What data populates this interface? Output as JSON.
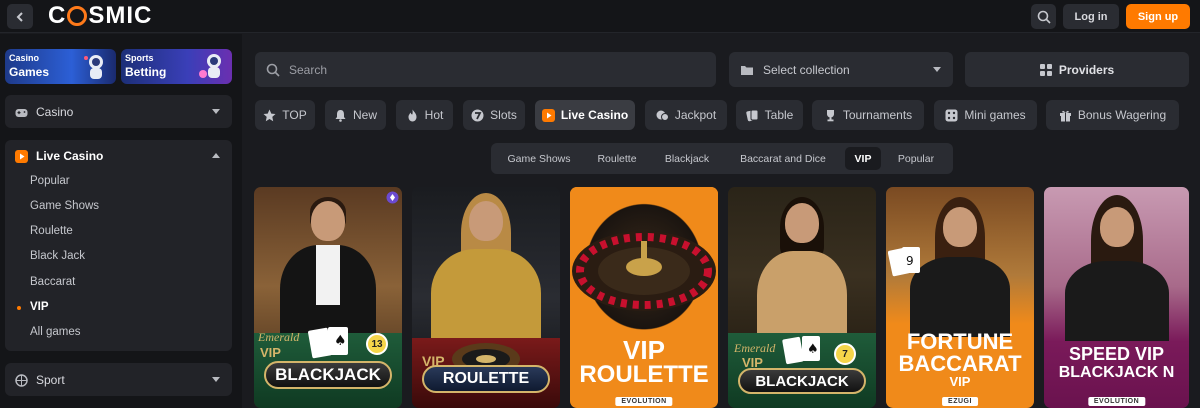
{
  "header": {
    "logo_text": "COSMIC",
    "login_label": "Log in",
    "signup_label": "Sign up",
    "accent": "#ff7a00"
  },
  "sidebar": {
    "promos": [
      {
        "small": "Casino",
        "big": "Games"
      },
      {
        "small": "Sports",
        "big": "Betting"
      }
    ],
    "casino_label": "Casino",
    "live_casino_label": "Live Casino",
    "live_casino_items": [
      {
        "label": "Popular"
      },
      {
        "label": "Game Shows"
      },
      {
        "label": "Roulette"
      },
      {
        "label": "Black Jack"
      },
      {
        "label": "Baccarat"
      },
      {
        "label": "VIP"
      },
      {
        "label": "All games"
      }
    ],
    "active_item": "VIP",
    "sport_label": "Sport"
  },
  "main": {
    "search_placeholder": "Search",
    "collection_label": "Select collection",
    "providers_label": "Providers",
    "categories": [
      {
        "label": "TOP",
        "icon": "star-icon"
      },
      {
        "label": "New",
        "icon": "bell-icon"
      },
      {
        "label": "Hot",
        "icon": "flame-icon"
      },
      {
        "label": "Slots",
        "icon": "seven-icon"
      },
      {
        "label": "Live Casino",
        "icon": "play-icon"
      },
      {
        "label": "Jackpot",
        "icon": "coins-icon"
      },
      {
        "label": "Table",
        "icon": "cards-icon"
      },
      {
        "label": "Tournaments",
        "icon": "trophy-icon"
      },
      {
        "label": "Mini games",
        "icon": "dice-icon"
      },
      {
        "label": "Bonus Wagering",
        "icon": "gift-icon"
      }
    ],
    "active_category": "Live Casino",
    "subcategories": [
      {
        "label": "Game Shows"
      },
      {
        "label": "Roulette"
      },
      {
        "label": "Blackjack"
      },
      {
        "label": "Baccarat and Dice"
      },
      {
        "label": "VIP"
      },
      {
        "label": "Popular"
      }
    ],
    "active_subcategory": "VIP",
    "games": [
      {
        "title": "BLACKJACK",
        "prefix": "VIP",
        "script": "Emerald",
        "number": "13"
      },
      {
        "title": "ROULETTE",
        "prefix": "VIP"
      },
      {
        "title_line1": "VIP",
        "title_line2": "ROULETTE",
        "provider": "EVOLUTION"
      },
      {
        "title": "BLACKJACK",
        "prefix": "VIP",
        "script": "Emerald",
        "number": "7"
      },
      {
        "title_line1": "FORTUNE",
        "title_line2": "BACCARAT",
        "title_line3": "VIP",
        "provider": "EZUGI"
      },
      {
        "title_line1": "SPEED VIP",
        "title_line2": "BLACKJACK N",
        "provider": "EVOLUTION"
      }
    ]
  }
}
